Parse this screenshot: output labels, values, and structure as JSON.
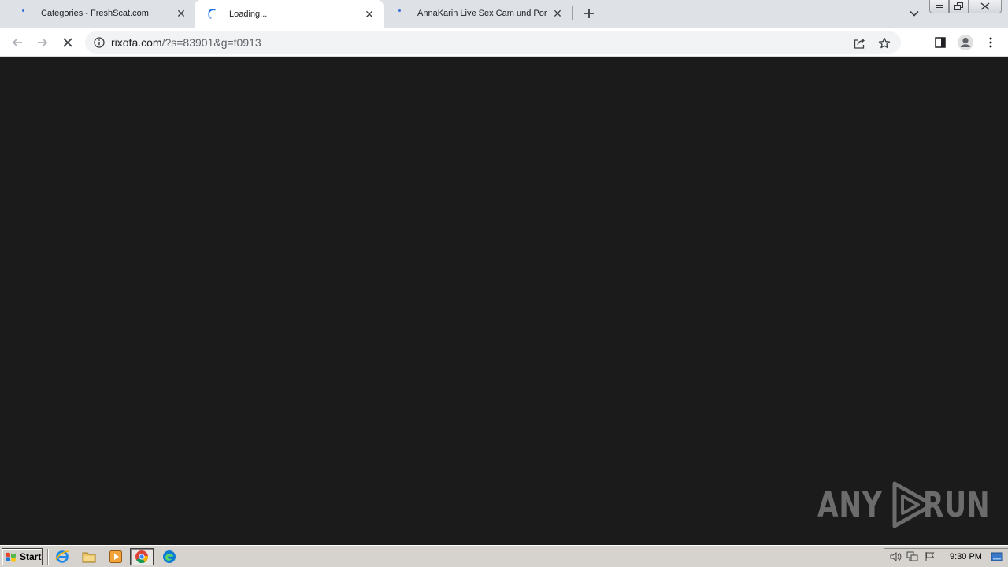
{
  "browser": {
    "tabs": [
      {
        "title": "Categories - FreshScat.com",
        "active": false,
        "loading": false
      },
      {
        "title": "Loading...",
        "active": true,
        "loading": true
      },
      {
        "title": "AnnaKarin Live Sex Cam und Porno C",
        "active": false,
        "loading": false
      }
    ],
    "new_tab_icon": "plus-icon",
    "address": {
      "host": "rixofa.com",
      "path": "/?s=83901&g=f0913"
    }
  },
  "watermark": {
    "left": "ANY",
    "right": "RUN"
  },
  "taskbar": {
    "start_label": "Start",
    "clock": "9:30 PM"
  },
  "colors": {
    "tabstrip": "#dee1e6",
    "content": "#1b1b1b",
    "taskbar": "#d6d3ce",
    "spinner": "#1a73e8"
  }
}
